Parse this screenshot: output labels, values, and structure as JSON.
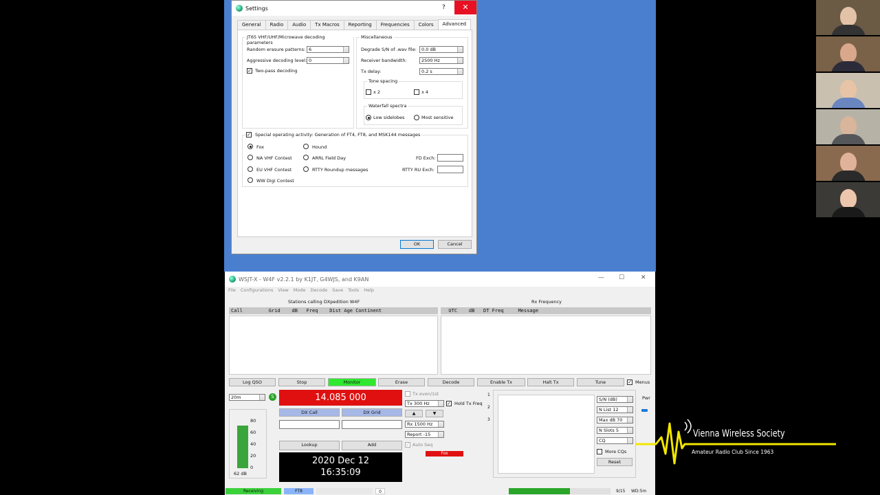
{
  "settings": {
    "title": "Settings",
    "help": "?",
    "close": "✕",
    "tabs": [
      "General",
      "Radio",
      "Audio",
      "Tx Macros",
      "Reporting",
      "Frequencies",
      "Colors",
      "Advanced"
    ],
    "jt65": {
      "label": "JT65 VHF/UHF/Microwave decoding parameters",
      "random_erasure_label": "Random erasure patterns:",
      "random_erasure_value": "6",
      "aggressive_label": "Aggressive decoding level:",
      "aggressive_value": "0",
      "two_pass_label": "Two-pass decoding",
      "two_pass_checked": "✓"
    },
    "misc": {
      "label": "Miscellaneous",
      "degrade_label": "Degrade S/N of .wav file:",
      "degrade_value": "0.0 dB",
      "bandwidth_label": "Receiver bandwidth:",
      "bandwidth_value": "2500  Hz",
      "txdelay_label": "Tx delay:",
      "txdelay_value": "0.2  s",
      "tone_spacing_label": "Tone spacing",
      "x2": "x 2",
      "x4": "x 4",
      "waterfall_label": "Waterfall spectra",
      "low_sidelobes": "Low sidelobes",
      "most_sensitive": "Most sensitive"
    },
    "special": {
      "label": "Special operating activity:  Generation of FT4, FT8, and MSK144 messages",
      "checked": "✓",
      "fox": "Fox",
      "hound": "Hound",
      "na_vhf": "NA VHF Contest",
      "arrl_fd": "ARRL Field Day",
      "eu_vhf": "EU VHF Contest",
      "rtty": "RTTY Roundup messages",
      "ww_digi": "WW Digi Contest",
      "fd_exch": "FD Exch:",
      "rtty_exch": "RTTY RU Exch:"
    },
    "ok": "OK",
    "cancel": "Cancel"
  },
  "wsjt": {
    "title": "WSJT-X - W4F   v2.2.1   by K1JT, G4WJS, and K9AN",
    "window_controls": {
      "min": "—",
      "max": "☐",
      "close": "✕"
    },
    "menus": [
      "File",
      "Configurations",
      "View",
      "Mode",
      "Decode",
      "Save",
      "Tools",
      "Help"
    ],
    "left_title": "Stations calling DXpedition W4F",
    "left_header": "Call         Grid    dB   Freq    Dist Age Continent",
    "right_title": "Rx Frequency",
    "right_header": "  UTC    dB   DT Freq     Message",
    "buttons": [
      "Log QSO",
      "Stop",
      "Monitor",
      "Erase",
      "Decode",
      "Enable Tx",
      "Halt Tx",
      "Tune"
    ],
    "menus_label": "Menus",
    "band": "20m",
    "s_label": "S",
    "frequency": "14.085 000",
    "dx_call_label": "DX Call",
    "dx_grid_label": "DX Grid",
    "lookup": "Lookup",
    "add": "Add",
    "date": "2020 Dec 12",
    "time": "16:35:09",
    "meter_ticks": [
      "80",
      "60",
      "40",
      "20",
      "0"
    ],
    "meter_level": "62 dB",
    "meter_fraction": 0.62,
    "tx_even": "Tx even/1st",
    "tx_freq": "Tx  300  Hz",
    "hold_tx": "Hold Tx Freq",
    "rx_freq": "Rx  1500  Hz",
    "report": "Report -15",
    "auto_seq": "Auto Seq",
    "fox_label": "Fox",
    "tab_numbers": [
      "1",
      "2",
      "3"
    ],
    "sn_select": "S/N (dB)",
    "n_list": "N List    12",
    "max_db": "Max dB  70",
    "n_slots": "N Slots    5",
    "cq_select": "CQ",
    "more_cqs": "More CQs",
    "reset": "Reset",
    "pwr": "Pwr",
    "status": {
      "receiving": "Receiving",
      "mode": "FT8",
      "count": "0",
      "progress": "9/15",
      "wd": "WD:5m",
      "progress_fraction": 0.6
    }
  },
  "logo": {
    "title": "Vienna Wireless Society",
    "subtitle": "Amateur Radio Club Since 1963"
  },
  "colors": {
    "desktop": "#4a7fd0",
    "close_red": "#e81123",
    "monitor_green": "#2fe82f",
    "freq_red": "#e01010",
    "status_green": "#3bd13b",
    "dx_blue": "#a6b8e6"
  }
}
